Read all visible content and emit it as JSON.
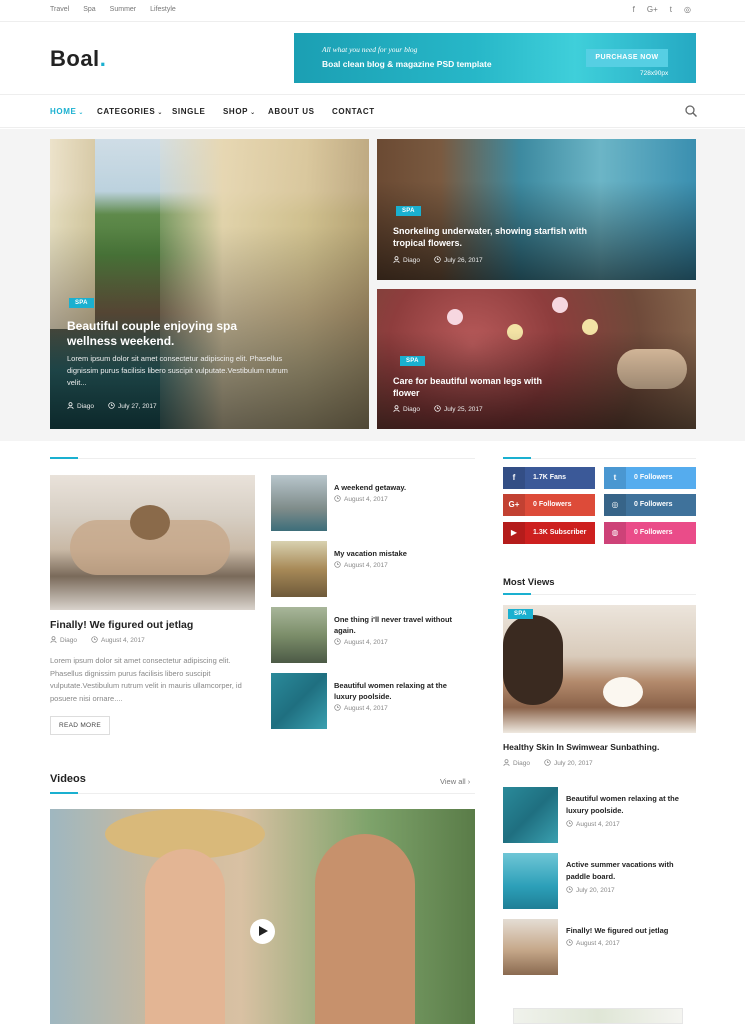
{
  "topbar": {
    "links": [
      "Travel",
      "Spa",
      "Summer",
      "Lifestyle"
    ],
    "social_icons": [
      "facebook-icon",
      "google-plus-icon",
      "twitter-icon",
      "instagram-icon"
    ],
    "social_glyphs": [
      "f",
      "G+",
      "t",
      "◎"
    ]
  },
  "header": {
    "logo": "Boal",
    "logo_dot": ".",
    "banner": {
      "line1": "All what you need for your blog",
      "line2": "Boal clean blog & magazine PSD template",
      "button": "PURCHASE NOW",
      "size": "728x90px"
    }
  },
  "nav": {
    "items": [
      {
        "label": "HOME",
        "dropdown": true
      },
      {
        "label": "CATEGORIES",
        "dropdown": true
      },
      {
        "label": "SINGLE",
        "dropdown": false
      },
      {
        "label": "SHOP",
        "dropdown": true
      },
      {
        "label": "ABOUT US",
        "dropdown": false
      },
      {
        "label": "CONTACT",
        "dropdown": false
      }
    ],
    "chevron": "⌄"
  },
  "hero": {
    "main": {
      "badge": "SPA",
      "title_line1": "Beautiful couple enjoying spa",
      "title_line2": "wellness weekend.",
      "excerpt_line1": "Lorem ipsum dolor sit amet consectetur adipiscing elit. Phasellus",
      "excerpt_line2": "dignissim purus facilisis libero suscipit vulputate.Vestibulum rutrum",
      "excerpt_line3": "velit...",
      "author": "Diago",
      "date": "July 27, 2017"
    },
    "right_top": {
      "badge": "SPA",
      "title_line1": "Snorkeling underwater, showing starfish with",
      "title_line2": "tropical flowers.",
      "author": "Diago",
      "date": "July 26, 2017"
    },
    "right_bottom": {
      "badge": "SPA",
      "title_line1": "Care for beautiful woman legs with",
      "title_line2": "flower",
      "author": "Diago",
      "date": "July 25, 2017"
    }
  },
  "featured": {
    "title": "Finally! We figured out jetlag",
    "author": "Diago",
    "date": "August 4, 2017",
    "excerpt": "Lorem ipsum dolor sit amet consectetur adipiscing elit. Phasellus dignissim purus facilisis libero suscipit vulputate.Vestibulum rutrum velit in mauris ullamcorper, id posuere nisi ornare....",
    "read_more": "READ MORE"
  },
  "list_posts": [
    {
      "title": "A weekend getaway.",
      "date": "August 4, 2017"
    },
    {
      "title": "My vacation mistake",
      "date": "August 4, 2017"
    },
    {
      "title": "One thing i'll never travel without again.",
      "date": "August 4, 2017"
    },
    {
      "title": "Beautiful women relaxing at the luxury poolside.",
      "date": "August 4, 2017"
    }
  ],
  "videos": {
    "title": "Videos",
    "view_all": "View all ›"
  },
  "sidebar": {
    "social": [
      {
        "icon": "facebook-icon",
        "glyph": "f",
        "label": "1.7K Fans",
        "color": "#3b5998"
      },
      {
        "icon": "twitter-icon",
        "glyph": "t",
        "label": "0 Followers",
        "color": "#55acee"
      },
      {
        "icon": "google-plus-icon",
        "glyph": "G+",
        "label": "0 Followers",
        "color": "#dd4b39"
      },
      {
        "icon": "instagram-icon",
        "glyph": "◎",
        "label": "0 Followers",
        "color": "#3f729b"
      },
      {
        "icon": "youtube-icon",
        "glyph": "▶",
        "label": "1.3K Subscriber",
        "color": "#cd201f"
      },
      {
        "icon": "dribbble-icon",
        "glyph": "◍",
        "label": "0 Followers",
        "color": "#ea4c89"
      }
    ],
    "most_views": {
      "title": "Most Views",
      "badge": "SPA",
      "post_title": "Healthy Skin In Swimwear Sunbathing.",
      "author": "Diago",
      "date": "July 20, 2017"
    },
    "posts": [
      {
        "title": "Beautiful women relaxing at the luxury poolside.",
        "date": "August 4, 2017"
      },
      {
        "title": "Active summer vacations with paddle board.",
        "date": "July 20, 2017"
      },
      {
        "title": "Finally! We figured out jetlag",
        "date": "August 4, 2017"
      }
    ]
  },
  "colors": {
    "accent": "#1ab0d0"
  }
}
